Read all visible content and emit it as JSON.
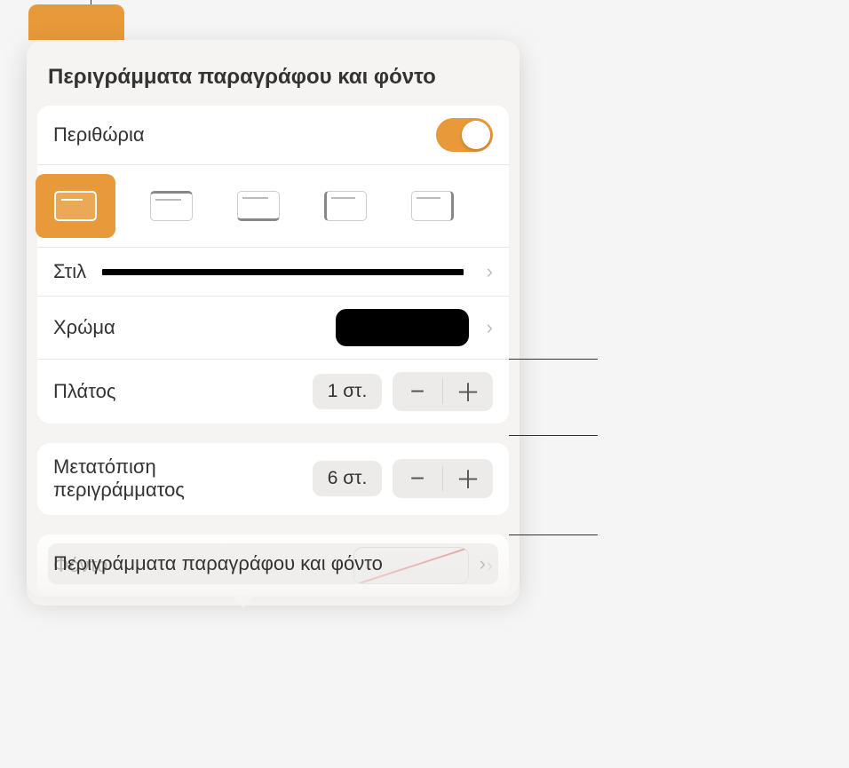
{
  "title": "Περιγράμματα παραγράφου και φόντο",
  "margins": {
    "label": "Περιθώρια",
    "toggle_on": true
  },
  "border_position": {
    "options": [
      "all",
      "top",
      "bottom",
      "left",
      "right"
    ],
    "selected": "all"
  },
  "style": {
    "label": "Στιλ"
  },
  "color": {
    "label": "Χρώμα",
    "value": "#000000"
  },
  "width": {
    "label": "Πλάτος",
    "value": "1 στ."
  },
  "offset": {
    "label_line1": "Μετατόπιση",
    "label_line2": "περιγράμματος",
    "value": "6 στ."
  },
  "background": {
    "label": "Φόντο",
    "value": "none"
  },
  "bottom_bar_label": "Περιγράμματα παραγράφου και φόντο",
  "icons": {
    "minus": "−",
    "plus": "＋",
    "chevron": "›"
  }
}
